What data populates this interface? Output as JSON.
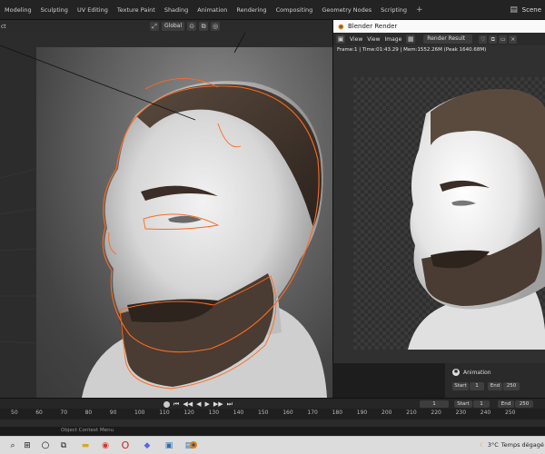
{
  "workspace_tabs": [
    "Modeling",
    "Sculpting",
    "UV Editing",
    "Texture Paint",
    "Shading",
    "Animation",
    "Rendering",
    "Compositing",
    "Geometry Nodes",
    "Scripting",
    "+"
  ],
  "scene": {
    "label": "Scene"
  },
  "viewport_header": {
    "left_label": "ct",
    "orientation": "Global"
  },
  "render_window": {
    "title": "Blender Render",
    "menus": [
      "View",
      "View",
      "Image"
    ],
    "slot_label": "Render Result",
    "info": "Frame:1 | Time:01:43.29 | Mem:1552.26M (Peak 1640.68M)"
  },
  "output_props": {
    "animation_label": "Animation",
    "start_label": "Start",
    "start_value": "1",
    "end_label": "End",
    "end_value": "250"
  },
  "timeline": {
    "current_frame": "1",
    "start_label": "Start",
    "start_value": "1",
    "end_label": "End",
    "end_value": "250",
    "ruler_ticks": [
      "50",
      "60",
      "70",
      "80",
      "90",
      "100",
      "110",
      "120",
      "130",
      "140",
      "150",
      "160",
      "170",
      "180",
      "190",
      "200",
      "210",
      "220",
      "230",
      "240",
      "250"
    ]
  },
  "status_bar": {
    "text": "Object Context Menu"
  },
  "taskbar": {
    "weather_temp": "3°C",
    "weather_desc": "Temps dégagé"
  },
  "icons": [
    "search-icon",
    "windows-icon",
    "task-view-icon",
    "file-explorer-icon",
    "chrome-icon",
    "opera-icon",
    "discord-icon",
    "photos-icon",
    "store-icon",
    "blender-icon",
    "moon-icon"
  ],
  "colors": {
    "selection_outline": "#ff6a1f",
    "blender_orange": "#e87d0d",
    "accent_blue": "#4772b3"
  }
}
